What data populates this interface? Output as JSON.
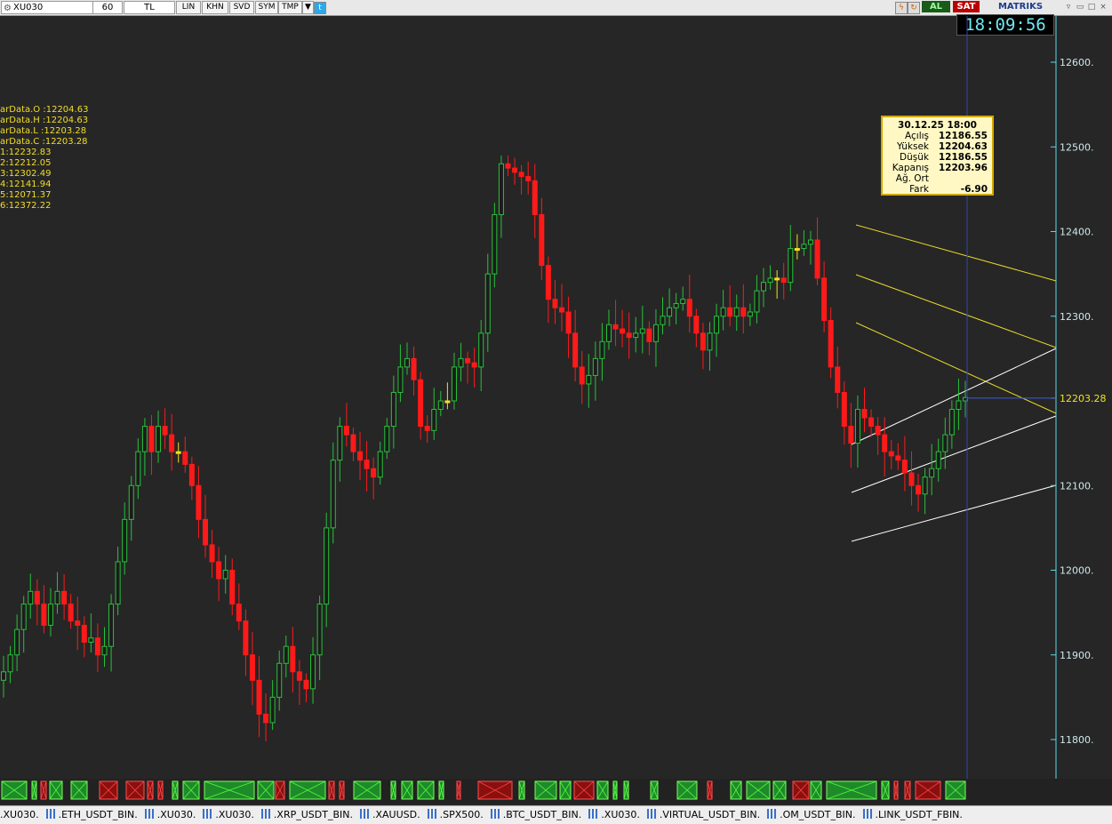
{
  "toolbar": {
    "symbol": "XU030",
    "period": "60",
    "currency": "TL",
    "buttons": [
      "LIN",
      "KHN",
      "SVD",
      "SYM",
      "TMP"
    ],
    "buy_label": "AL",
    "sell_label": "SAT",
    "logo": "MATRIKS",
    "colors": {
      "buy": "#1a5a1a",
      "sell": "#bb0000"
    }
  },
  "clock": "18:09:56",
  "indicators": [
    "arData.O :12204.63",
    "arData.H :12204.63",
    "arData.L :12203.28",
    "arData.C :12203.28",
    "1:12232.83",
    "2:12212.05",
    "3:12302.49",
    "4:12141.94",
    "5:12071.37",
    "6:12372.22"
  ],
  "infobox": {
    "date": "30.12.25 18:00",
    "rows": [
      {
        "label": "Açılış",
        "value": "12186.55"
      },
      {
        "label": "Yüksek",
        "value": "12204.63"
      },
      {
        "label": "Düşük",
        "value": "12186.55"
      },
      {
        "label": "Kapanış",
        "value": "12203.96"
      },
      {
        "label": "Ağ. Ort",
        "value": ""
      },
      {
        "label": "Fark",
        "value": "-6.90"
      }
    ]
  },
  "chart_data": {
    "type": "candlestick",
    "y_ticks": [
      "12600.",
      "12500.",
      "12400.",
      "12300.",
      "12203.28",
      "12100.",
      "12000.",
      "11900.",
      "11800."
    ],
    "last_price": "12203.28",
    "ylim": [
      11755,
      12655
    ],
    "colors": {
      "up": "#27c23a",
      "down": "#ff1a1a",
      "doji": "#f2e21c",
      "line_yellow": "#e6d92a",
      "line_white": "#ffffff",
      "axis": "#5fd8e8"
    },
    "closes": [
      11880,
      11900,
      11930,
      11960,
      11975,
      11960,
      11935,
      11960,
      11975,
      11960,
      11940,
      11935,
      11915,
      11920,
      11900,
      11910,
      11960,
      12010,
      12060,
      12100,
      12140,
      12170,
      12140,
      12170,
      12160,
      12140,
      12140,
      12125,
      12100,
      12060,
      12030,
      12010,
      11990,
      12000,
      11960,
      11940,
      11900,
      11870,
      11830,
      11820,
      11850,
      11890,
      11910,
      11880,
      11870,
      11860,
      11900,
      11960,
      12050,
      12130,
      12170,
      12160,
      12140,
      12130,
      12120,
      12110,
      12140,
      12170,
      12210,
      12240,
      12250,
      12225,
      12170,
      12165,
      12190,
      12200,
      12200,
      12240,
      12250,
      12245,
      12240,
      12280,
      12350,
      12420,
      12480,
      12475,
      12470,
      12465,
      12460,
      12420,
      12360,
      12320,
      12310,
      12305,
      12280,
      12240,
      12220,
      12230,
      12250,
      12270,
      12290,
      12285,
      12280,
      12275,
      12280,
      12285,
      12270,
      12290,
      12300,
      12310,
      12315,
      12320,
      12300,
      12280,
      12260,
      12280,
      12300,
      12310,
      12300,
      12310,
      12300,
      12305,
      12330,
      12340,
      12345,
      12345,
      12340,
      12380,
      12380,
      12385,
      12390,
      12345,
      12295,
      12240,
      12210,
      12170,
      12150,
      12190,
      12180,
      12170,
      12160,
      12140,
      12135,
      12130,
      12115,
      12100,
      12090,
      12110,
      12120,
      12140,
      12160,
      12190,
      12200,
      12204
    ]
  },
  "bottom_tabs": [
    ".XU030.",
    ".ETH_USDT_BIN.",
    ".XU030.",
    ".XU030.",
    ".XRP_USDT_BIN.",
    ".XAUUSD.",
    ".SPX500.",
    ".BTC_USDT_BIN.",
    ".XU030.",
    ".VIRTUAL_USDT_BIN.",
    ".OM_USDT_BIN.",
    ".LINK_USDT_FBIN."
  ]
}
